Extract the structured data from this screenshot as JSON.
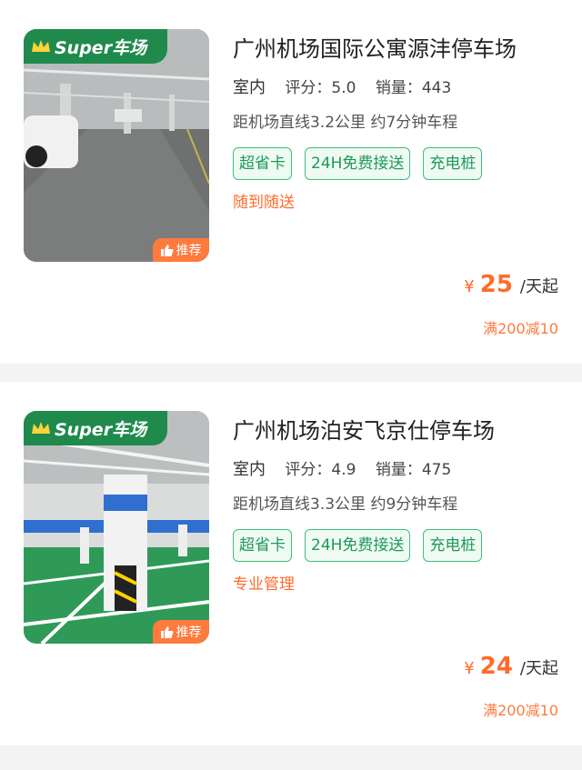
{
  "lots": [
    {
      "super_label": "Super车场",
      "recommend_label": "推荐",
      "title": "广州机场国际公寓源沣停车场",
      "type": "室内",
      "rating_label": "评分：5.0",
      "sales_label": "销量：443",
      "distance": "距机场直线3.2公里 约7分钟车程",
      "tags": [
        "超省卡",
        "24H免费接送",
        "充电桩"
      ],
      "service": "随到随送",
      "price_currency": "¥",
      "price_value": "25",
      "price_unit": "/天起",
      "discount": "满200减10"
    },
    {
      "super_label": "Super车场",
      "recommend_label": "推荐",
      "title": "广州机场泊安飞京仕停车场",
      "type": "室内",
      "rating_label": "评分：4.9",
      "sales_label": "销量：475",
      "distance": "距机场直线3.3公里 约9分钟车程",
      "tags": [
        "超省卡",
        "24H免费接送",
        "充电桩"
      ],
      "service": "专业管理",
      "price_currency": "¥",
      "price_value": "24",
      "price_unit": "/天起",
      "discount": "满200减10"
    }
  ],
  "icons": {
    "crown": "crown-icon",
    "thumbs_up": "thumbs-up-icon"
  },
  "colors": {
    "brand_green": "#1f8a4c",
    "accent_orange": "#ff6b2c",
    "tag_green": "#3ec07a"
  }
}
